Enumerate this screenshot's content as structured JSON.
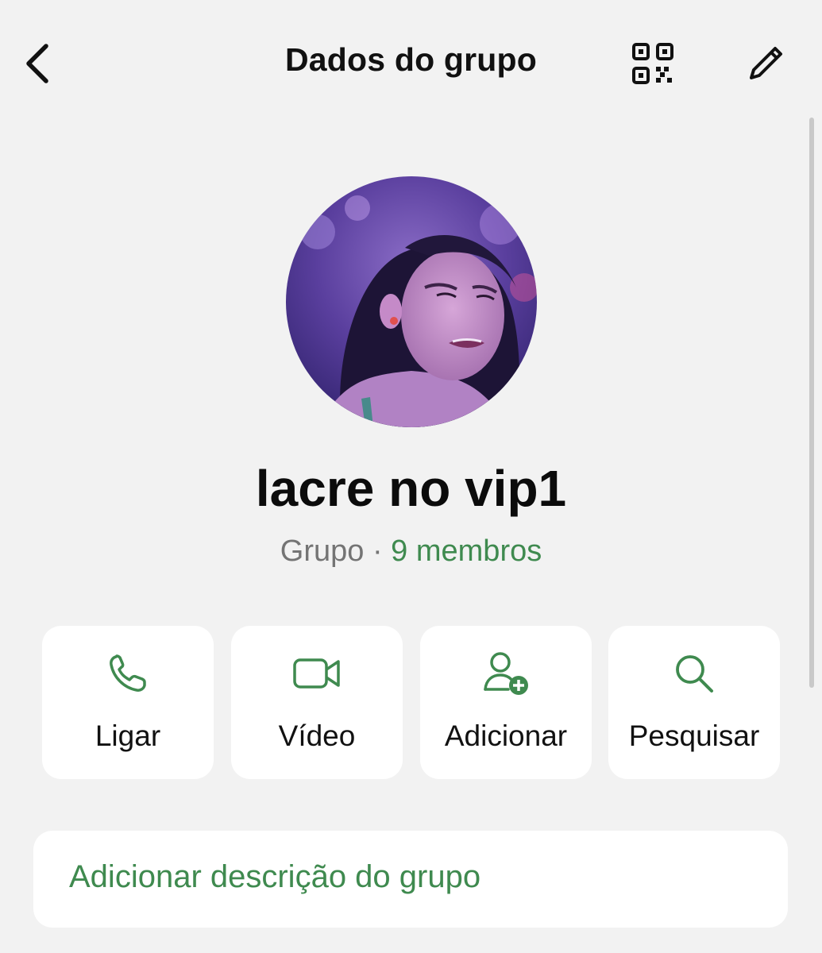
{
  "header": {
    "title": "Dados do grupo",
    "back_icon": "chevron-left-icon",
    "qr_icon": "qr-code-icon",
    "edit_icon": "pencil-icon"
  },
  "group": {
    "name": "lacre no vip1",
    "type_label": "Grupo",
    "separator": " · ",
    "members_label": "9 membros",
    "avatar": "group-photo"
  },
  "actions": [
    {
      "label": "Ligar",
      "icon": "phone-icon"
    },
    {
      "label": "Vídeo",
      "icon": "video-camera-icon"
    },
    {
      "label": "Adicionar",
      "icon": "add-user-icon"
    },
    {
      "label": "Pesquisar",
      "icon": "search-icon"
    }
  ],
  "description": {
    "label": "Adicionar descrição do grupo"
  },
  "colors": {
    "accent": "#3f8a4f",
    "background": "#f2f2f2",
    "card": "#ffffff",
    "subtitle_gray": "#747474"
  }
}
